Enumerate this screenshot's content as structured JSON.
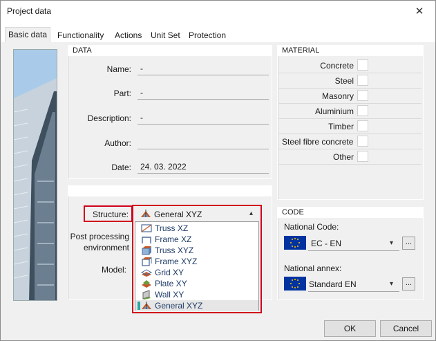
{
  "window": {
    "title": "Project data",
    "close_label": "✕"
  },
  "tabs": [
    {
      "label": "Basic data",
      "active": true
    },
    {
      "label": "Functionality"
    },
    {
      "label": "Actions"
    },
    {
      "label": "Unit Set"
    },
    {
      "label": "Protection"
    }
  ],
  "data_group": {
    "header": "DATA",
    "fields": [
      {
        "label": "Name:",
        "value": "-"
      },
      {
        "label": "Part:",
        "value": "-"
      },
      {
        "label": "Description:",
        "value": "-"
      },
      {
        "label": "Author:",
        "value": ""
      },
      {
        "label": "Date:",
        "value": "24. 03. 2022"
      }
    ]
  },
  "material_group": {
    "header": "MATERIAL",
    "items": [
      {
        "label": "Concrete",
        "checked": false
      },
      {
        "label": "Steel",
        "checked": false
      },
      {
        "label": "Masonry",
        "checked": false
      },
      {
        "label": "Aluminium",
        "checked": false
      },
      {
        "label": "Timber",
        "checked": false
      },
      {
        "label": "Steel fibre concrete",
        "checked": false
      },
      {
        "label": "Other",
        "checked": false
      }
    ]
  },
  "structure": {
    "label": "Structure:",
    "selected": "General XYZ",
    "post_processing_label": "Post processing environment",
    "model_label": "Model:",
    "options": [
      "Truss XZ",
      "Frame XZ",
      "Truss XYZ",
      "Frame XYZ",
      "Grid XY",
      "Plate XY",
      "Wall XY",
      "General XYZ"
    ]
  },
  "code_group": {
    "header": "CODE",
    "national_code_label": "National Code:",
    "national_code_value": "EC - EN",
    "national_annex_label": "National annex:",
    "national_annex_value": "Standard EN",
    "browse_label": "..."
  },
  "buttons": {
    "ok": "OK",
    "cancel": "Cancel"
  },
  "colors": {
    "highlight": "#d0021b",
    "flag_blue": "#0033a0",
    "flag_stars": "#ffcc00"
  }
}
